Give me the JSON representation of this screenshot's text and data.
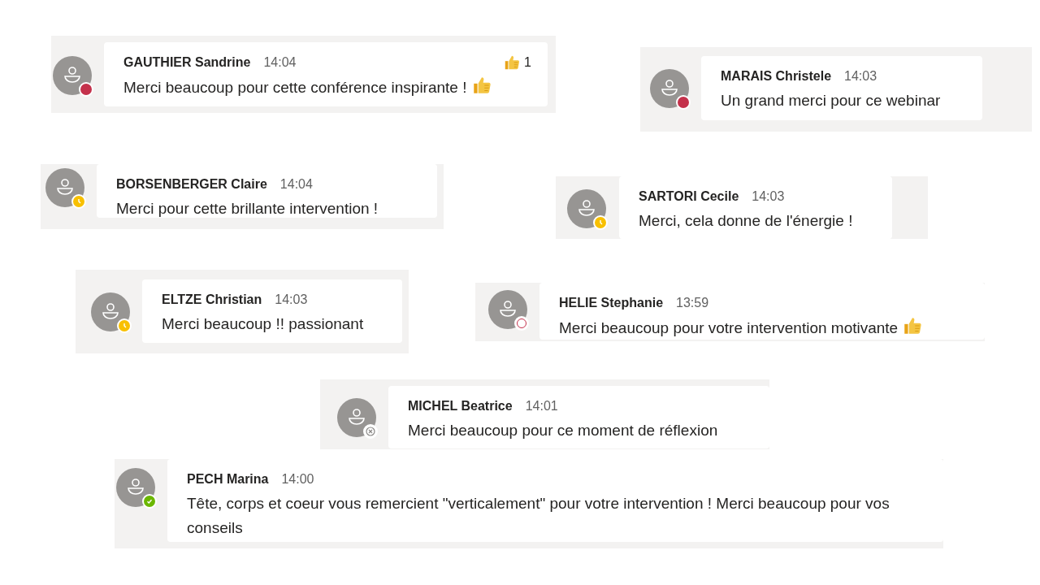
{
  "messages": [
    {
      "name": "GAUTHIER Sandrine",
      "time": "14:04",
      "text": "Merci beaucoup pour cette conférence inspirante !",
      "status": {
        "kind": "busy"
      },
      "emoji": {
        "kind": "thumbs_up"
      },
      "reaction": {
        "kind": "thumbs_up",
        "count": "1"
      }
    },
    {
      "name": "MARAIS Christele",
      "time": "14:03",
      "text": "Un grand merci pour ce webinar",
      "status": {
        "kind": "busy"
      }
    },
    {
      "name": "BORSENBERGER Claire",
      "time": "14:04",
      "text": "Merci pour cette brillante intervention !",
      "status": {
        "kind": "away"
      }
    },
    {
      "name": "SARTORI Cecile",
      "time": "14:03",
      "text": "Merci, cela donne de l'énergie !",
      "status": {
        "kind": "away"
      }
    },
    {
      "name": "ELTZE Christian",
      "time": "14:03",
      "text": "Merci beaucoup !! passionant",
      "status": {
        "kind": "away"
      }
    },
    {
      "name": "HELIE Stephanie",
      "time": "13:59",
      "text": "Merci beaucoup pour votre intervention motivante",
      "status": {
        "kind": "dnd"
      },
      "emoji": {
        "kind": "thumbs_up"
      }
    },
    {
      "name": "MICHEL Beatrice",
      "time": "14:01",
      "text": "Merci beaucoup pour ce moment de réflexion",
      "status": {
        "kind": "offline"
      }
    },
    {
      "name": "PECH Marina",
      "time": "14:00",
      "text": "Tête, corps et coeur vous remercient \"verticalement\" pour votre intervention ! Merci beaucoup pour vos conseils",
      "status": {
        "kind": "available"
      }
    }
  ]
}
